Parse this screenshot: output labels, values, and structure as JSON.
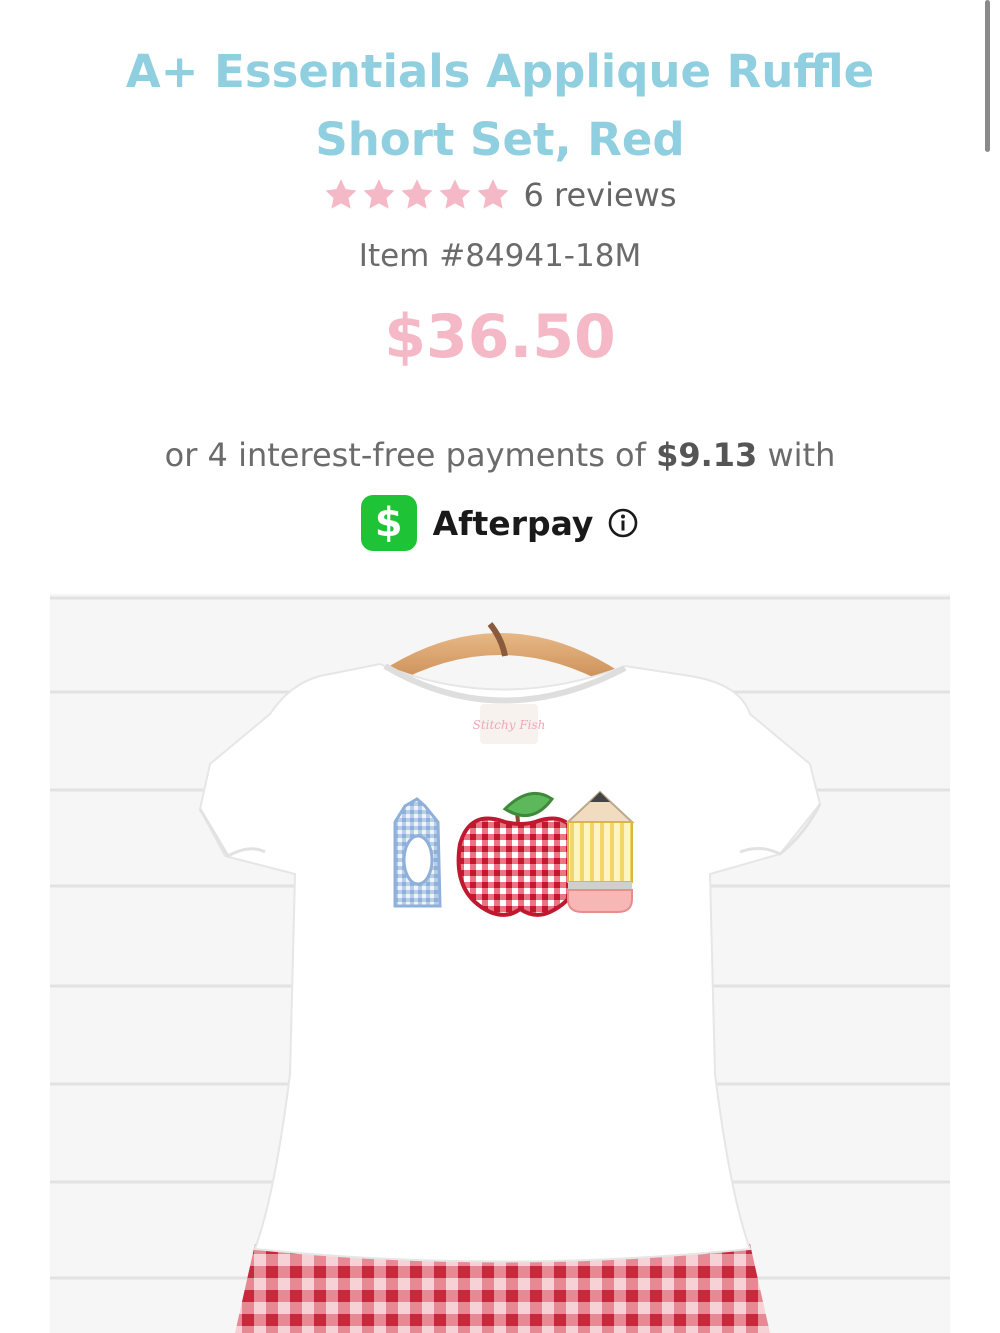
{
  "product": {
    "title": "A+ Essentials Applique Ruffle Short Set, Red",
    "rating": 5,
    "rating_max": 5,
    "reviews_label": "6 reviews",
    "item_number": "Item #84941-18M",
    "price": "$36.50"
  },
  "installments": {
    "prefix": "or 4 interest-free payments of",
    "amount": "$9.13",
    "suffix": "with",
    "provider_label": "Afterpay",
    "provider_icon": "dollar-sign-icon",
    "info_icon": "info-icon"
  },
  "image": {
    "tag_text": "Stitchy Fish",
    "icon": "product-photo"
  },
  "colors": {
    "title": "#8fcfe0",
    "star": "#f5b8c6",
    "price": "#f5b8c6",
    "cash_green": "#1ec435"
  }
}
